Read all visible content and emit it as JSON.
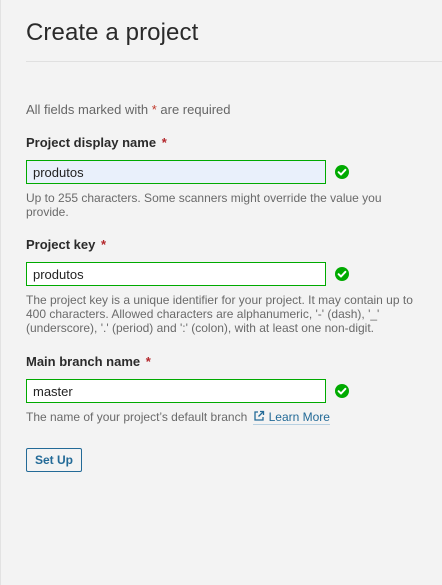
{
  "header": {
    "title": "Create a project"
  },
  "form": {
    "required_prefix": "All fields marked with ",
    "required_star": "*",
    "required_suffix": " are required",
    "fields": [
      {
        "label": "Project display name",
        "required_star": "*",
        "value": "produtos",
        "help": "Up to 255 characters. Some scanners might override the value you provide.",
        "valid": true
      },
      {
        "label": "Project key",
        "required_star": "*",
        "value": "produtos",
        "help": "The project key is a unique identifier for your project. It may contain up to 400 characters. Allowed characters are alphanumeric, '-' (dash), '_' (underscore), '.' (period) and ':' (colon), with at least one non-digit.",
        "valid": true
      },
      {
        "label": "Main branch name",
        "required_star": "*",
        "value": "master",
        "help": "The name of your project’s default branch",
        "help_link": "Learn More",
        "valid": true
      }
    ],
    "submit_label": "Set Up"
  },
  "colors": {
    "valid": "#00aa00",
    "required": "#b3262b",
    "link": "#236a97"
  },
  "icons": {
    "valid": "check-circle-icon",
    "external_link": "external-link-icon"
  }
}
